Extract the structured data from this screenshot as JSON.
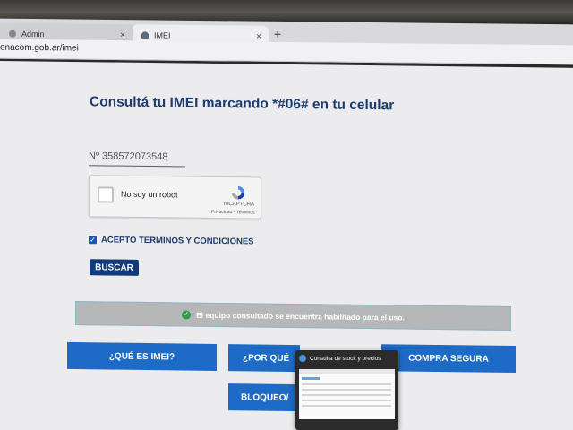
{
  "browser": {
    "tabs": [
      {
        "label": "Admin",
        "close": "×",
        "active": false
      },
      {
        "label": "IMEI",
        "close": "×",
        "active": true
      }
    ],
    "new_tab": "+",
    "url": "enacom.gob.ar/imei"
  },
  "page": {
    "title": "Consultá tu IMEI marcando *#06# en tu celular",
    "imei_field": {
      "value": "Nº  358572073548"
    },
    "recaptcha": {
      "label": "No soy un robot",
      "brand": "reCAPTCHA",
      "legal": "Privacidad - Términos",
      "checked": false
    },
    "terms": {
      "label": "ACEPTO TERMINOS Y CONDICIONES",
      "checked": true
    },
    "search_button": "BUSCAR",
    "result": {
      "icon": "check-circle-icon",
      "message": "El equipo consultado se encuentra habilitado para el uso."
    },
    "nav_buttons": {
      "que_es_imei": "¿QUÉ ES IMEI?",
      "por_que": "¿POR QUÉ",
      "compra_segura": "COMPRA SEGURA",
      "bloqueo": "BLOQUEO/"
    }
  },
  "popup": {
    "title": "Consulta de stock y precios"
  },
  "colors": {
    "title": "#1c3b6e",
    "buscar": "#123a78",
    "nav_button": "#1d6ac7",
    "result_bg": "#b5b7b9",
    "ok_icon": "#2e9b4e"
  }
}
